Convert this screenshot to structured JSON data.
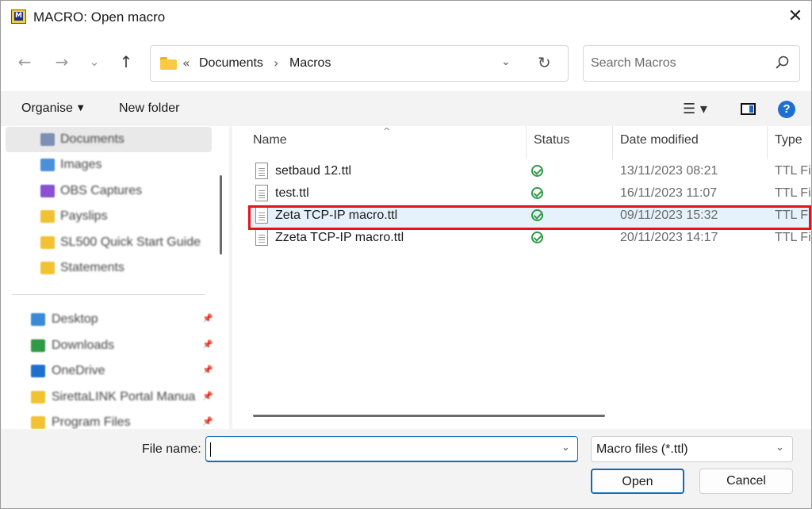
{
  "window": {
    "title": "MACRO: Open macro",
    "close_glyph": "✕",
    "app_icon_letter": "M"
  },
  "nav": {
    "back": "←",
    "forward": "→",
    "recent": "⌄",
    "up": "↑"
  },
  "address": {
    "overflow": "«",
    "crumbs": [
      "Documents",
      "Macros"
    ],
    "sep": "›",
    "dropdown": "⌄",
    "refresh": "↻"
  },
  "search": {
    "placeholder": "Search Macros"
  },
  "toolbar": {
    "organise": "Organise",
    "new_folder": "New folder",
    "view_glyph": "☰ ▾",
    "help": "?"
  },
  "sidebar": {
    "items": [
      {
        "label": "Documents",
        "icon": "documents-icon",
        "color": "#7e8fb5",
        "selected": true
      },
      {
        "label": "Images",
        "icon": "images-icon",
        "color": "#4a8fd9"
      },
      {
        "label": "OBS Captures",
        "icon": "obs-captures-icon",
        "color": "#8a4fd2"
      },
      {
        "label": "Payslips",
        "icon": "folder-icon",
        "color": "#f1c232"
      },
      {
        "label": "SL500 Quick Start Guide",
        "icon": "folder-icon",
        "color": "#f1c232"
      },
      {
        "label": "Statements",
        "icon": "folder-icon",
        "color": "#f1c232"
      },
      {
        "label": "Desktop",
        "icon": "desktop-icon",
        "color": "#3a8ad6",
        "pinned": true
      },
      {
        "label": "Downloads",
        "icon": "downloads-icon",
        "color": "#2f9a46",
        "pinned": true
      },
      {
        "label": "OneDrive",
        "icon": "onedrive-icon",
        "color": "#1f6fd1",
        "pinned": true
      },
      {
        "label": "SirettaLINK Portal Manua",
        "icon": "folder-icon",
        "color": "#f1c232",
        "pinned": true
      },
      {
        "label": "Program Files",
        "icon": "folder-icon",
        "color": "#f1c232",
        "pinned": true
      }
    ],
    "pin_glyph": "📌"
  },
  "columns": {
    "name": "Name",
    "status": "Status",
    "date": "Date modified",
    "type": "Type",
    "sort_glyph": "^"
  },
  "files": [
    {
      "name": "setbaud 12.ttl",
      "date": "13/11/2023 08:21",
      "type": "TTL File"
    },
    {
      "name": "test.ttl",
      "date": "16/11/2023 11:07",
      "type": "TTL File"
    },
    {
      "name": "Zeta TCP-IP macro.ttl",
      "date": "09/11/2023 15:32",
      "type": "TTL File",
      "highlighted": true
    },
    {
      "name": "Zzeta TCP-IP macro.ttl",
      "date": "20/11/2023 14:17",
      "type": "TTL File"
    }
  ],
  "bottom": {
    "file_name_label": "File name:",
    "file_name_value": "",
    "file_type": "Macro files (*.ttl)",
    "chevron": "⌄",
    "open": "Open",
    "cancel": "Cancel"
  },
  "colors": {
    "accent": "#0f6cbd",
    "highlight": "#e5f1fb",
    "annotation": "#e4141a",
    "status_ok": "#2f9a46"
  }
}
